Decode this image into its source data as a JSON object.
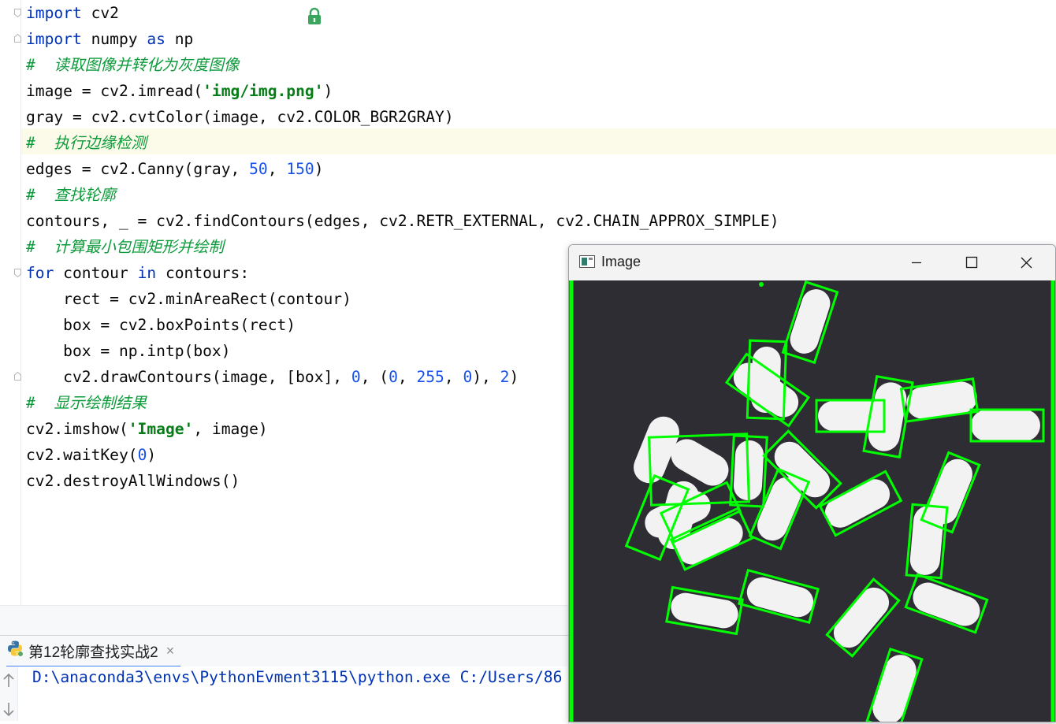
{
  "editor": {
    "lines": [
      {
        "tokens": [
          {
            "t": "import",
            "c": "kw"
          },
          {
            "t": " cv2"
          }
        ]
      },
      {
        "tokens": [
          {
            "t": "import",
            "c": "kw"
          },
          {
            "t": " numpy "
          },
          {
            "t": "as",
            "c": "kw"
          },
          {
            "t": " np"
          }
        ]
      },
      {
        "tokens": [
          {
            "t": "#  读取图像并转化为灰度图像",
            "c": "cm"
          }
        ]
      },
      {
        "tokens": [
          {
            "t": "image = cv2.imread("
          },
          {
            "t": "'img/img.png'",
            "c": "str"
          },
          {
            "t": ")"
          }
        ]
      },
      {
        "tokens": [
          {
            "t": "gray = cv2.cvtColor(image, cv2.COLOR_BGR2GRAY)"
          }
        ]
      },
      {
        "tokens": [
          {
            "t": "#  执行边缘检测",
            "c": "cm"
          }
        ]
      },
      {
        "tokens": [
          {
            "t": "edges = cv2.Canny(gray, "
          },
          {
            "t": "50",
            "c": "num"
          },
          {
            "t": ", "
          },
          {
            "t": "150",
            "c": "num"
          },
          {
            "t": ")"
          }
        ]
      },
      {
        "tokens": [
          {
            "t": "#  查找轮廓",
            "c": "cm"
          }
        ]
      },
      {
        "tokens": [
          {
            "t": "contours, _ = cv2.findContours(edges, cv2.RETR_EXTERNAL, cv2.CHAIN_APPROX_SIMPLE)"
          }
        ]
      },
      {
        "tokens": [
          {
            "t": "#  计算最小包围矩形并绘制",
            "c": "cm"
          }
        ]
      },
      {
        "tokens": [
          {
            "t": "for",
            "c": "kw"
          },
          {
            "t": " contour "
          },
          {
            "t": "in",
            "c": "kw"
          },
          {
            "t": " contours:"
          }
        ]
      },
      {
        "tokens": [
          {
            "t": "    rect = cv2.minAreaRect(contour)"
          }
        ]
      },
      {
        "tokens": [
          {
            "t": "    box = cv2.boxPoints(rect)"
          }
        ]
      },
      {
        "tokens": [
          {
            "t": "    box = np.intp(box)"
          }
        ]
      },
      {
        "tokens": [
          {
            "t": "    cv2.drawContours(image, [box], "
          },
          {
            "t": "0",
            "c": "num"
          },
          {
            "t": ", ("
          },
          {
            "t": "0",
            "c": "num"
          },
          {
            "t": ", "
          },
          {
            "t": "255",
            "c": "num"
          },
          {
            "t": ", "
          },
          {
            "t": "0",
            "c": "num"
          },
          {
            "t": "), "
          },
          {
            "t": "2",
            "c": "num"
          },
          {
            "t": ")"
          }
        ]
      },
      {
        "tokens": [
          {
            "t": "#  显示绘制结果",
            "c": "cm"
          }
        ]
      },
      {
        "tokens": [
          {
            "t": "cv2.imshow("
          },
          {
            "t": "'Image'",
            "c": "str"
          },
          {
            "t": ", image)"
          }
        ]
      },
      {
        "tokens": [
          {
            "t": "cv2.waitKey("
          },
          {
            "t": "0",
            "c": "num"
          },
          {
            "t": ")"
          }
        ]
      },
      {
        "tokens": [
          {
            "t": "cv2.destroyAllWindows()"
          }
        ]
      }
    ]
  },
  "run": {
    "tab_label": "第12轮廓查找实战2",
    "close_glyph": "×",
    "console_line": "D:\\anaconda3\\envs\\PythonEvment3115\\python.exe C:/Users/86"
  },
  "image_window": {
    "title": "Image",
    "min_glyph": "—",
    "max_glyph": "☐",
    "close_glyph": "✕",
    "box_color": "#00ff00",
    "pill_color": "#f2f2f2",
    "background_color": "#2e2d33"
  },
  "icons": {
    "lock": "lock-icon",
    "python": "python-icon",
    "app": "image-window-icon"
  }
}
